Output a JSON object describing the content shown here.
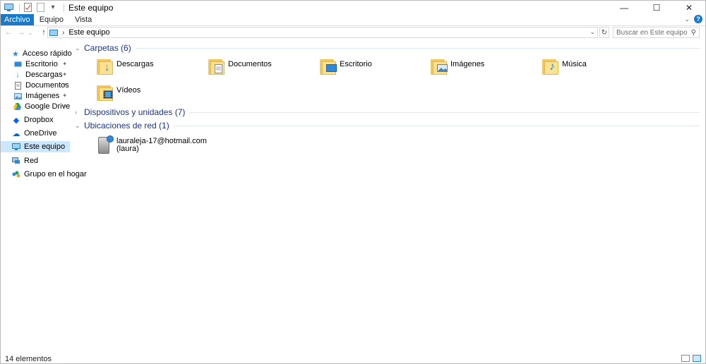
{
  "window": {
    "title": "Este equipo"
  },
  "window_controls": {
    "minimize": "—",
    "maximize": "☐",
    "close": "✕"
  },
  "ribbon": {
    "tabs": [
      "Archivo",
      "Equipo",
      "Vista"
    ],
    "active_tab": "Archivo",
    "accent": "#1979ca"
  },
  "address": {
    "back_glyph": "←",
    "forward_glyph": "→",
    "up_glyph": "↑",
    "crumb_sep": "›",
    "breadcrumb": "Este equipo",
    "dropdown_glyph": "⌄",
    "refresh_glyph": "↻",
    "search_placeholder": "Buscar en Este equipo",
    "search_glyph": "⚲"
  },
  "sidebar": {
    "items": [
      {
        "label": "Acceso rápido",
        "icon": "star-icon",
        "glyph": "★",
        "color": "#2f89d9",
        "pinned": false
      },
      {
        "label": "Escritorio",
        "icon": "desktop-icon",
        "glyph": "▬",
        "color": "#2f89d9",
        "pinned": true
      },
      {
        "label": "Descargas",
        "icon": "download-icon",
        "glyph": "↓",
        "color": "#2f89d9",
        "pinned": true
      },
      {
        "label": "Documentos",
        "icon": "document-icon",
        "glyph": "▤",
        "color": "#7a7a7a",
        "pinned": true
      },
      {
        "label": "Imágenes",
        "icon": "image-icon",
        "glyph": "▣",
        "color": "#5a8fc7",
        "pinned": true
      },
      {
        "label": "Google Drive",
        "icon": "google-drive-icon",
        "glyph": "▲",
        "color": "#1fa463",
        "pinned": true
      },
      {
        "label": "Dropbox",
        "icon": "dropbox-icon",
        "glyph": "◆",
        "color": "#0061fe",
        "pinned": false
      },
      {
        "label": "OneDrive",
        "icon": "onedrive-icon",
        "glyph": "☁",
        "color": "#0a64c2",
        "pinned": false
      },
      {
        "label": "Este equipo",
        "icon": "computer-icon",
        "glyph": "▭",
        "color": "#2f89d9",
        "pinned": false,
        "selected": true
      },
      {
        "label": "Red",
        "icon": "network-icon",
        "glyph": "▦",
        "color": "#2f89d9",
        "pinned": false
      },
      {
        "label": "Grupo en el hogar",
        "icon": "homegroup-icon",
        "glyph": "✤",
        "color": "#1fa463",
        "pinned": false
      }
    ],
    "pin_glyph": "📌"
  },
  "groups": {
    "folders": {
      "header": "Carpetas (6)",
      "items": [
        {
          "label": "Descargas",
          "icon": "downloads-folder-icon",
          "glyph": "↓",
          "color": "#2f89d9"
        },
        {
          "label": "Documentos",
          "icon": "documents-folder-icon",
          "glyph": "▤",
          "color": "#888888"
        },
        {
          "label": "Escritorio",
          "icon": "desktop-folder-icon",
          "glyph": "▬",
          "color": "#2f89d9"
        },
        {
          "label": "Imágenes",
          "icon": "pictures-folder-icon",
          "glyph": "▣",
          "color": "#4f7fae"
        },
        {
          "label": "Música",
          "icon": "music-folder-icon",
          "glyph": "♪",
          "color": "#2f89d9"
        },
        {
          "label": "Vídeos",
          "icon": "videos-folder-icon",
          "glyph": "▦",
          "color": "#3b3b3b"
        }
      ]
    },
    "devices": {
      "header": "Dispositivos y unidades (7)"
    },
    "network": {
      "header": "Ubicaciones de red (1)",
      "items": [
        {
          "line1": "lauraleja-17@hotmail.com",
          "line2": "(laura)",
          "icon": "network-drive-icon"
        }
      ]
    }
  },
  "status": {
    "count": "14 elementos"
  },
  "colors": {
    "group_header": "#1e3287",
    "selection": "#cce8ff"
  }
}
